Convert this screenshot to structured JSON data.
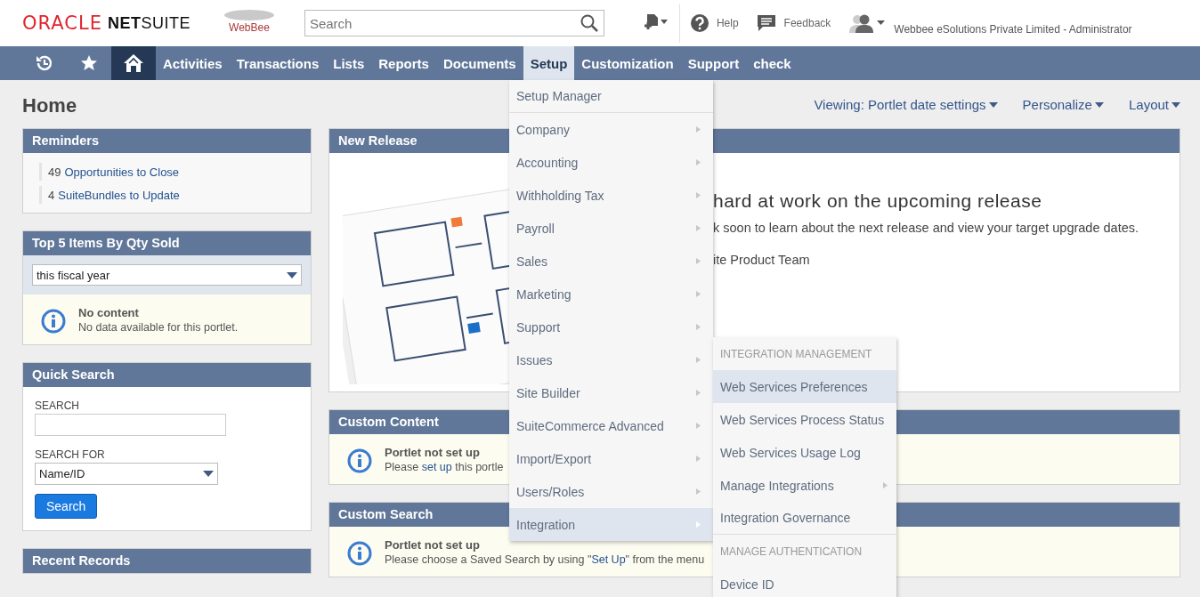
{
  "header": {
    "logo_oracle": "ORACLE",
    "logo_netsuite": "**NET**SUITE",
    "logo_partner": "WebBee",
    "search": {
      "placeholder": "Search"
    },
    "help": "Help",
    "feedback": "Feedback",
    "account": "Webbee eSolutions Private Limited - Administrator"
  },
  "nav": [
    {
      "kind": "recent",
      "selected": false
    },
    {
      "kind": "star",
      "selected": false
    },
    {
      "kind": "home",
      "selected": true
    },
    {
      "kind": "text",
      "label": "Activities",
      "selected": false
    },
    {
      "kind": "text",
      "label": "Transactions",
      "selected": false
    },
    {
      "kind": "text",
      "label": "Lists",
      "selected": false
    },
    {
      "kind": "text",
      "label": "Reports",
      "selected": false
    },
    {
      "kind": "text",
      "label": "Documents",
      "selected": false
    },
    {
      "kind": "text",
      "label": "Setup",
      "selected": true
    },
    {
      "kind": "text",
      "label": "Customization",
      "selected": false
    },
    {
      "kind": "text",
      "label": "Support",
      "selected": false
    },
    {
      "kind": "text",
      "label": "check",
      "selected": false
    }
  ],
  "page_title": "Home",
  "view_links": [
    "Viewing: Portlet date settings",
    "Personalize",
    "Layout"
  ],
  "left_portlets": [
    {
      "kind": "reminders",
      "title": "Reminders",
      "items": [
        {
          "count": "49",
          "label": "Opportunities to Close"
        },
        {
          "count": "4",
          "label": "SuiteBundles to Update"
        }
      ]
    },
    {
      "kind": "select_notice",
      "title": "Top 5 Items By Qty Sold",
      "select_value": "this fiscal year",
      "notice_title": "No content",
      "notice_text": [
        {
          "text": "No data available for this portlet.",
          "link": false
        }
      ]
    },
    {
      "kind": "search",
      "title": "Quick Search",
      "search_label": "SEARCH",
      "search_for_label": "SEARCH FOR",
      "search_for_value": "Name/ID",
      "button": "Search"
    },
    {
      "kind": "header_only",
      "title": "Recent Records"
    }
  ],
  "right_portlets": [
    {
      "kind": "release",
      "title": "New Release",
      "heading": "hard at work on the upcoming release",
      "text": "k soon to learn about the next release and view your target upgrade dates.",
      "signature": "ite Product Team"
    },
    {
      "kind": "notice",
      "title": "Custom Content",
      "notice_title": "Portlet not set up",
      "notice_text": [
        {
          "text": "Please ",
          "link": false
        },
        {
          "text": "set up",
          "link": true
        },
        {
          "text": " this portle",
          "link": false
        }
      ]
    },
    {
      "kind": "notice",
      "title": "Custom Search",
      "notice_title": "Portlet not set up",
      "notice_text": [
        {
          "text": "Please choose a Saved Search by using \"",
          "link": false
        },
        {
          "text": "Set Up",
          "link": true
        },
        {
          "text": "\" from the menu",
          "link": false
        }
      ]
    }
  ],
  "setup_menu": [
    {
      "label": "Setup Manager",
      "submenu": false,
      "selected": false,
      "divider_after": true
    },
    {
      "label": "Company",
      "submenu": true,
      "selected": false,
      "divider_after": false
    },
    {
      "label": "Accounting",
      "submenu": true,
      "selected": false,
      "divider_after": false
    },
    {
      "label": "Withholding Tax",
      "submenu": true,
      "selected": false,
      "divider_after": false
    },
    {
      "label": "Payroll",
      "submenu": true,
      "selected": false,
      "divider_after": false
    },
    {
      "label": "Sales",
      "submenu": true,
      "selected": false,
      "divider_after": false
    },
    {
      "label": "Marketing",
      "submenu": true,
      "selected": false,
      "divider_after": false
    },
    {
      "label": "Support",
      "submenu": true,
      "selected": false,
      "divider_after": false
    },
    {
      "label": "Issues",
      "submenu": true,
      "selected": false,
      "divider_after": false
    },
    {
      "label": "Site Builder",
      "submenu": true,
      "selected": false,
      "divider_after": false
    },
    {
      "label": "SuiteCommerce Advanced",
      "submenu": true,
      "selected": false,
      "divider_after": false
    },
    {
      "label": "Import/Export",
      "submenu": true,
      "selected": false,
      "divider_after": false
    },
    {
      "label": "Users/Roles",
      "submenu": true,
      "selected": false,
      "divider_after": false
    },
    {
      "label": "Integration",
      "submenu": true,
      "selected": true,
      "divider_after": false
    }
  ],
  "integration_menu": [
    {
      "kind": "header",
      "label": "INTEGRATION MANAGEMENT",
      "divider_after": false
    },
    {
      "kind": "item",
      "label": "Web Services Preferences",
      "submenu": false,
      "selected": true,
      "divider_after": false
    },
    {
      "kind": "item",
      "label": "Web Services Process Status",
      "submenu": false,
      "selected": false,
      "divider_after": false
    },
    {
      "kind": "item",
      "label": "Web Services Usage Log",
      "submenu": false,
      "selected": false,
      "divider_after": false
    },
    {
      "kind": "item",
      "label": "Manage Integrations",
      "submenu": true,
      "selected": false,
      "divider_after": false
    },
    {
      "kind": "item",
      "label": "Integration Governance",
      "submenu": false,
      "selected": false,
      "divider_after": true
    },
    {
      "kind": "header",
      "label": "MANAGE AUTHENTICATION",
      "divider_after": false
    },
    {
      "kind": "item",
      "label": "Device ID",
      "submenu": false,
      "selected": false,
      "divider_after": false
    }
  ]
}
